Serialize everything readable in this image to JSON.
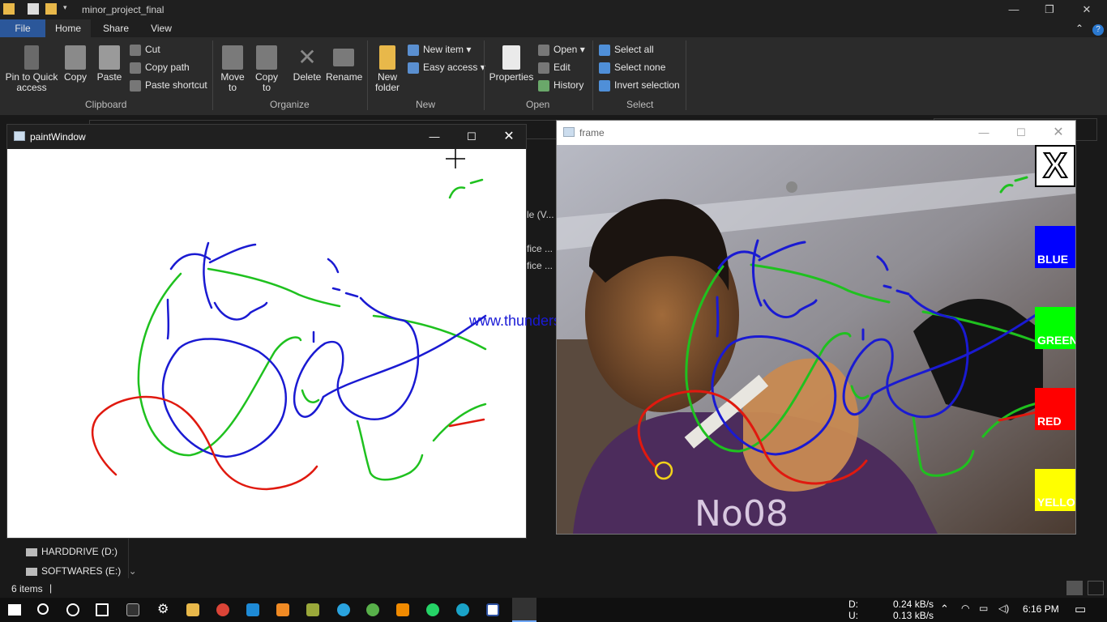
{
  "explorer": {
    "title": "minor_project_final",
    "tabs": [
      "File",
      "Home",
      "Share",
      "View"
    ],
    "clipboard": {
      "pin_to_quick_access": "Pin to Quick access",
      "copy": "Copy",
      "paste": "Paste",
      "cut": "Cut",
      "copy_path": "Copy path",
      "paste_shortcut": "Paste shortcut",
      "group_label": "Clipboard"
    },
    "organize": {
      "move_to": "Move to",
      "copy_to": "Copy to",
      "delete": "Delete",
      "rename": "Rename",
      "group_label": "Organize"
    },
    "new": {
      "new_folder": "New folder",
      "new_item": "New item",
      "easy_access": "Easy access",
      "group_label": "New"
    },
    "open": {
      "properties": "Properties",
      "open": "Open",
      "edit": "Edit",
      "history": "History",
      "group_label": "Open"
    },
    "select": {
      "select_all": "Select all",
      "select_none": "Select none",
      "invert_selection": "Invert selection",
      "group_label": "Select"
    },
    "nav_items": [
      "HARDDRIVE (D:)",
      "SOFTWARES (E:)"
    ],
    "file_fragments": [
      "le (V...",
      "fice ...",
      "fice ..."
    ],
    "status_items": "6 items"
  },
  "paint_window": {
    "title": "paintWindow"
  },
  "frame_window": {
    "title": "frame",
    "buttons": {
      "clear": "X",
      "blue": "BLUE",
      "green": "GREEN",
      "red": "RED",
      "yellow": "YELLOW"
    },
    "shirt_text": "No08"
  },
  "watermark": "www.thundershare.net",
  "taskbar": {
    "net_down_label": "D:",
    "net_up_label": "U:",
    "net_down": "0.24 kB/s",
    "net_up": "0.13 kB/s",
    "time": "6:16 PM"
  },
  "colors": {
    "file_tab": "#2b579a",
    "stroke_blue": "#1a1ad2",
    "stroke_green": "#1fc11f",
    "stroke_red": "#e0190f",
    "button_blue": "#0000ff",
    "button_green": "#00ff00",
    "button_red": "#ff0000",
    "button_yellow": "#ffff00"
  }
}
